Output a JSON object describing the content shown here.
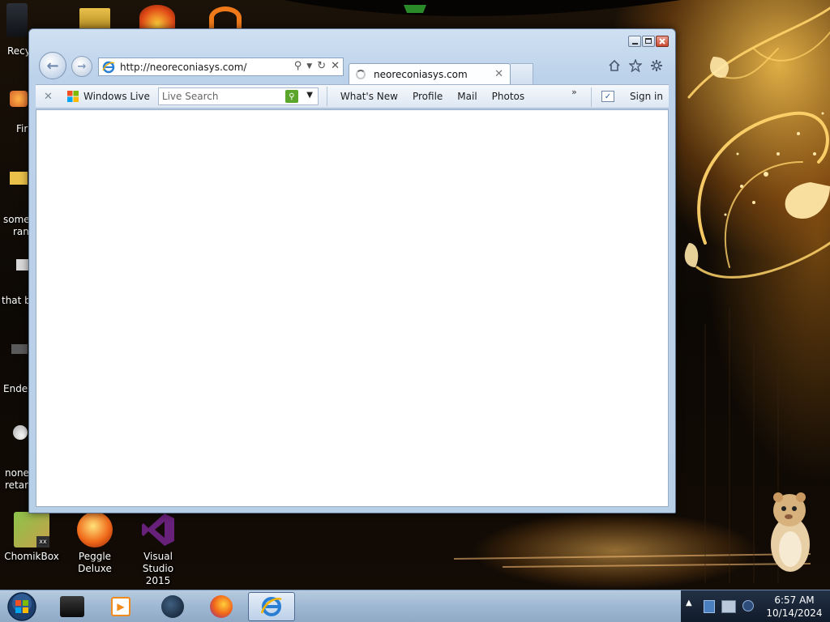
{
  "desktop": {
    "left_edge_labels": [
      "Recy",
      "Fir",
      "some",
      "ran",
      "that b",
      "Ender",
      "none",
      "retarc"
    ],
    "icons": [
      {
        "label": "ChomikBox"
      },
      {
        "label": "Peggle Deluxe"
      },
      {
        "label_line1": "Visual Studio",
        "label_line2": "2015"
      }
    ]
  },
  "browser": {
    "address_url": "http://neoreconiasys.com/",
    "tab_title": "neoreconiasys.com",
    "command_bar": {
      "windows_live_label": "Windows Live",
      "search_placeholder": "Live Search",
      "links": [
        "What's New",
        "Profile",
        "Mail",
        "Photos"
      ],
      "overflow": "»",
      "sign_in": "Sign in"
    }
  },
  "taskbar": {
    "clock_time": "6:57 AM",
    "clock_date": "10/14/2024"
  },
  "colors": {
    "window_frame": "#bcd2ea",
    "taskbar": "#9fb8d2",
    "search_go": "#5aa52a",
    "close_button": "#c9482f"
  }
}
